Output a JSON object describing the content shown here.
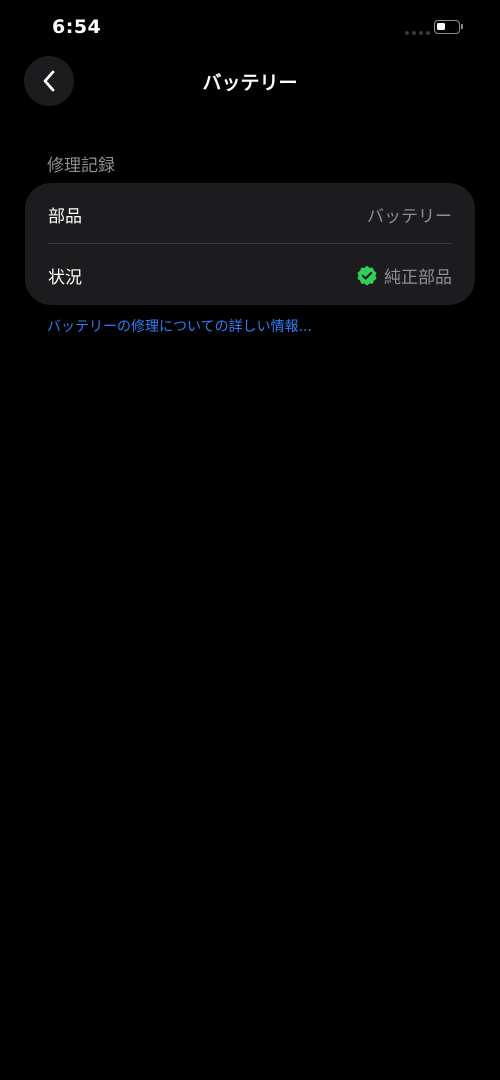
{
  "status_bar": {
    "time": "6:54",
    "battery_icon": "battery-low-icon"
  },
  "nav": {
    "title": "バッテリー",
    "back_icon": "chevron-left-icon"
  },
  "section": {
    "header": "修理記録",
    "rows": [
      {
        "label": "部品",
        "value": "バッテリー"
      },
      {
        "label": "状況",
        "value": "純正部品",
        "icon": "verified-badge-icon"
      }
    ]
  },
  "link": {
    "text": "バッテリーの修理についての詳しい情報..."
  },
  "colors": {
    "background": "#000000",
    "card": "#1c1c1e",
    "secondary_text": "#8e8e93",
    "link": "#2f7df6",
    "verified_green": "#30d158"
  }
}
